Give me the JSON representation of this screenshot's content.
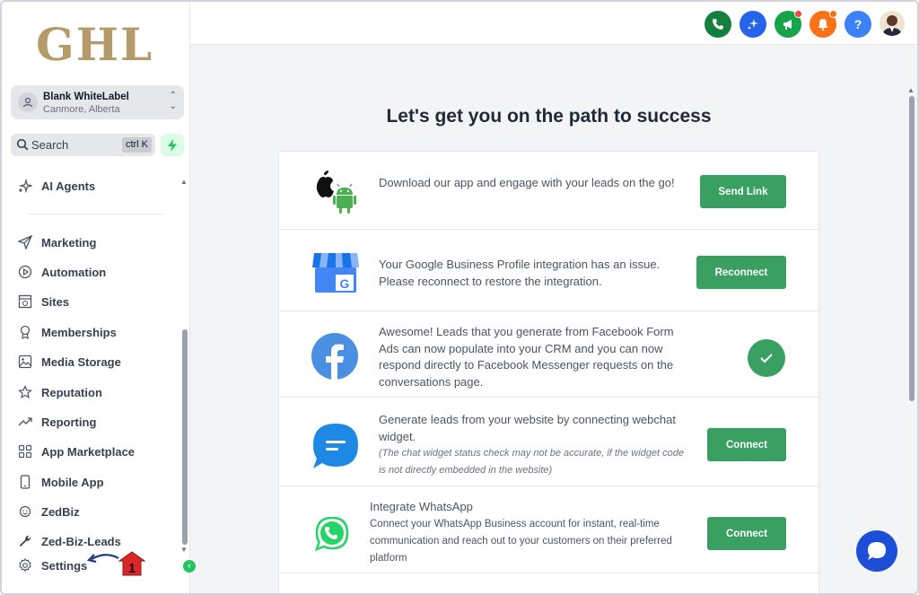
{
  "brand": {
    "logo_text": "GHL"
  },
  "location": {
    "name": "Blank WhiteLabel",
    "address": "Canmore, Alberta"
  },
  "search": {
    "placeholder": "Search",
    "shortcut": "ctrl K"
  },
  "sidebar": {
    "items": [
      {
        "label": "AI Agents",
        "icon": "sparkle-icon"
      },
      {
        "label": "Marketing",
        "icon": "send-icon"
      },
      {
        "label": "Automation",
        "icon": "automation-icon"
      },
      {
        "label": "Sites",
        "icon": "sites-icon"
      },
      {
        "label": "Memberships",
        "icon": "award-icon"
      },
      {
        "label": "Media Storage",
        "icon": "image-icon"
      },
      {
        "label": "Reputation",
        "icon": "star-icon"
      },
      {
        "label": "Reporting",
        "icon": "trend-icon"
      },
      {
        "label": "App Marketplace",
        "icon": "grid-icon"
      },
      {
        "label": "Mobile App",
        "icon": "phone-icon"
      },
      {
        "label": "ZedBiz",
        "icon": "smile-icon"
      },
      {
        "label": "Zed-Biz-Leads",
        "icon": "wrench-icon"
      },
      {
        "label": "Settings",
        "icon": "gear-icon"
      }
    ],
    "annotation_number": "1"
  },
  "main": {
    "heading": "Let's get you on the path to success",
    "rows": [
      {
        "icon": "apple-android-icon",
        "text": "Download our app and engage with your leads on the go!",
        "button": "Send Link"
      },
      {
        "icon": "google-business-icon",
        "text": "Your Google Business Profile integration has an issue. Please reconnect to restore the integration.",
        "button": "Reconnect"
      },
      {
        "icon": "facebook-icon",
        "text": "Awesome! Leads that you generate from Facebook Form Ads can now populate into your CRM and you can now respond directly to Facebook Messenger requests on the conversations page.",
        "status": "done"
      },
      {
        "icon": "webchat-icon",
        "text": "Generate leads from your website by connecting webchat widget.",
        "note": "(The chat widget status check may not be accurate, if the widget code is not directly embedded in the website)",
        "button": "Connect"
      },
      {
        "icon": "whatsapp-icon",
        "title": "Integrate WhatsApp",
        "text": "Connect your WhatsApp Business account for instant, real-time communication and reach out to your customers on their preferred platform",
        "button": "Connect"
      }
    ]
  },
  "topbar": {
    "buttons": [
      {
        "icon": "phone-icon",
        "color": "#15803d"
      },
      {
        "icon": "magic-icon",
        "color": "#2563eb"
      },
      {
        "icon": "megaphone-icon",
        "color": "#16a34a"
      },
      {
        "icon": "bell-icon",
        "color": "#f97316"
      },
      {
        "icon": "help-icon",
        "color": "#3b82f6",
        "glyph": "?"
      }
    ]
  },
  "colors": {
    "accent_green": "#3aa062",
    "logo_gold": "#b59a6a",
    "fab_blue": "#1d4ed8"
  }
}
